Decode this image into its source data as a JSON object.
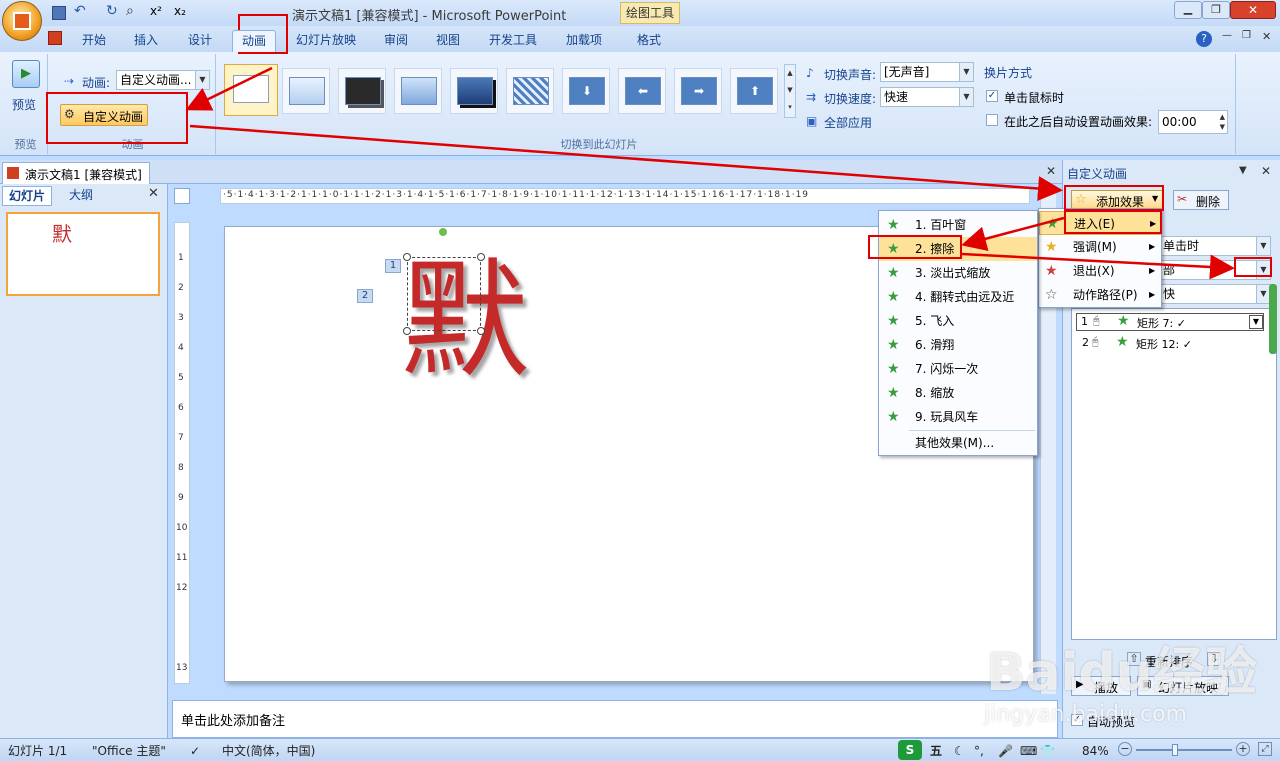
{
  "title": {
    "doc": "演示文稿1 [兼容模式] - Microsoft PowerPoint",
    "context_tab": "绘图工具"
  },
  "tabs": [
    "开始",
    "插入",
    "设计",
    "动画",
    "幻灯片放映",
    "审阅",
    "视图",
    "开发工具",
    "加载项",
    "格式"
  ],
  "ribbon": {
    "preview_label": "预览",
    "preview_group": "预览",
    "anim_label": "动画:",
    "anim_value": "自定义动画...",
    "custom_anim_btn": "自定义动画",
    "anim_group": "动画",
    "trans_group": "切换到此幻灯片",
    "sound_label": "切换声音:",
    "sound_value": "[无声音]",
    "speed_label": "切换速度:",
    "speed_value": "快速",
    "apply_all": "全部应用",
    "advance_title": "换片方式",
    "on_click": "单击鼠标时",
    "auto_after": "在此之后自动设置动画效果:",
    "auto_time": "00:00"
  },
  "doc_tab": "演示文稿1 [兼容模式]",
  "panel_tabs": {
    "slides": "幻灯片",
    "outline": "大纲"
  },
  "slide_num": "1",
  "slide_char": "默",
  "ruler_text": "·5·1·4·1·3·1·2·1·1·1·0·1·1·1·2·1·3·1·4·1·5·1·6·1·7·1·8·1·9·1·10·1·11·1·12·1·13·1·14·1·15·1·16·1·17·1·18·1·19",
  "vruler": [
    "1",
    "2",
    "3",
    "4",
    "5",
    "6",
    "7",
    "8",
    "9",
    "10",
    "11",
    "12",
    "13"
  ],
  "tags": [
    "1",
    "2"
  ],
  "notes": "单击此处添加备注",
  "effects_menu": [
    "1. 百叶窗",
    "2. 擦除",
    "3. 淡出式缩放",
    "4. 翻转式由远及近",
    "5. 飞入",
    "6. 滑翔",
    "7. 闪烁一次",
    "8. 缩放",
    "9. 玩具风车",
    "其他效果(M)..."
  ],
  "add_menu": [
    "进入(E)",
    "强调(M)",
    "退出(X)",
    "动作路径(P)"
  ],
  "task_pane": {
    "title": "自定义动画",
    "add_effect": "添加效果",
    "delete": "删除",
    "start_value": "单击时",
    "prop_value": "部",
    "speed_value": "快",
    "items": [
      {
        "num": "1",
        "name": "矩形 7: ✓"
      },
      {
        "num": "2",
        "name": "矩形 12: ✓"
      }
    ],
    "reorder": "重新排序",
    "play": "播放",
    "slideshow": "幻灯片放映",
    "autopreview": "自动预览"
  },
  "status": {
    "slide": "幻灯片 1/1",
    "theme": "\"Office 主题\"",
    "lang": "中文(简体，中国)",
    "zoom": "84%",
    "ime": "五"
  },
  "watermark": {
    "brand": "Baidu经验",
    "url": "jingyan.baidu.com"
  }
}
